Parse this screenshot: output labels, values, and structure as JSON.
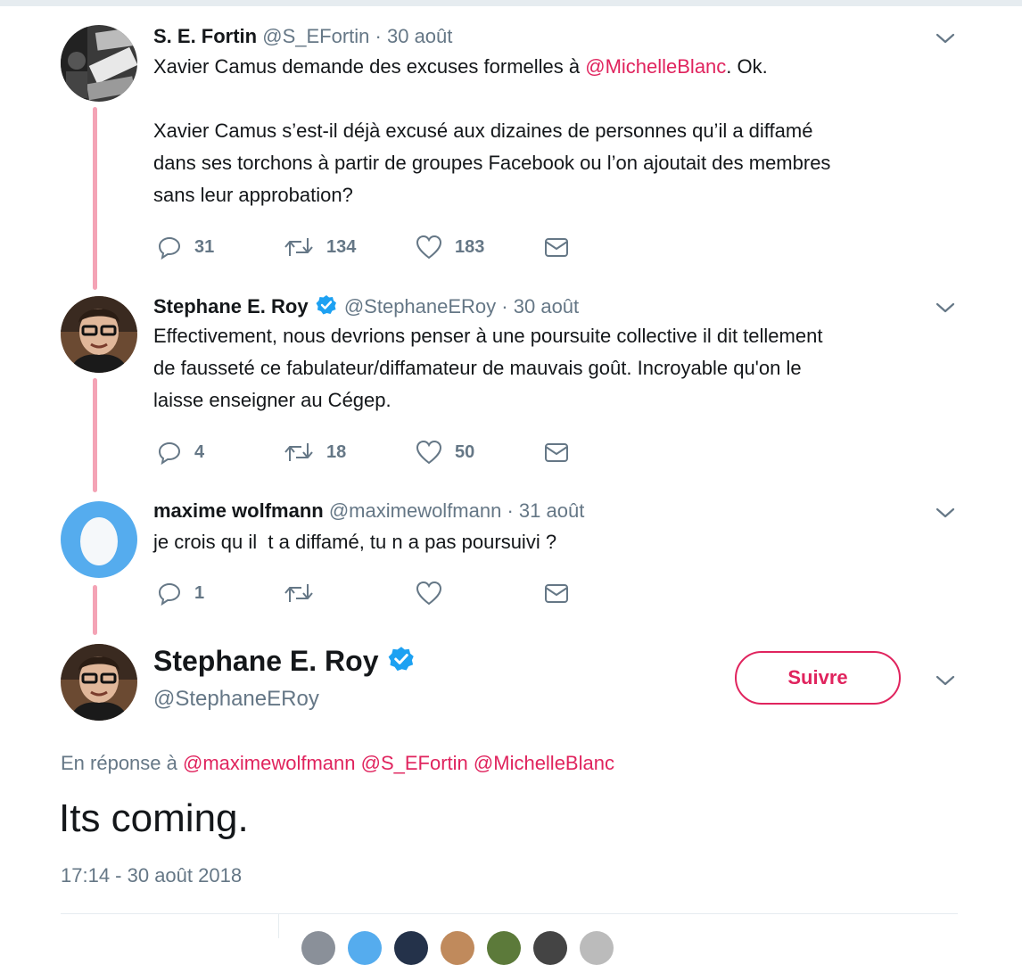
{
  "thread": [
    {
      "name": "S. E. Fortin",
      "handle": "@S_EFortin",
      "date": "30 août",
      "text_lines": [
        [
          "Xavier Camus demande des excuses formelles à ",
          "@MichelleBlanc",
          ". Ok."
        ],
        "",
        "Xavier Camus s’est-il déjà excusé aux dizaines de personnes qu’il a diffamé",
        "dans ses torchons à partir de groupes Facebook ou l’on ajoutait des membres",
        "sans leur approbation?"
      ],
      "replies": "31",
      "retweets": "134",
      "likes": "183"
    },
    {
      "name": "Stephane E. Roy",
      "verified": true,
      "handle": "@StephaneERoy",
      "date": "30 août",
      "text_lines": [
        "Effectivement, nous devrions penser à une poursuite collective il dit tellement",
        "de fausseté ce fabulateur/diffamateur de mauvais goût. Incroyable qu'on le",
        "laisse enseigner au Cégep."
      ],
      "replies": "4",
      "retweets": "18",
      "likes": "50"
    },
    {
      "name": "maxime wolfmann",
      "handle": "@maximewolfmann",
      "date": "31 août",
      "text_lines": [
        "je crois qu il  t a diffamé, tu n a pas poursuivi ?"
      ],
      "replies": "1",
      "retweets": "",
      "likes": ""
    }
  ],
  "main_tweet": {
    "name": "Stephane E. Roy",
    "handle": "@StephaneERoy",
    "follow_label": "Suivre",
    "reply_prefix": "En réponse à",
    "reply_mentions": [
      "@maximewolfmann",
      "@S_EFortin",
      "@MichelleBlanc"
    ],
    "text": "Its coming.",
    "timestamp": "17:14 - 30 août 2018"
  },
  "icons": {
    "reply": "reply-icon",
    "retweet": "retweet-icon",
    "like": "heart-icon",
    "dm": "envelope-icon",
    "more": "chevron-down-icon",
    "verified": "verified-badge-icon"
  },
  "colors": {
    "accent": "#e0245e",
    "thread_line": "#f4a3b5",
    "secondary_text": "#657786",
    "verified": "#1da1f2"
  }
}
